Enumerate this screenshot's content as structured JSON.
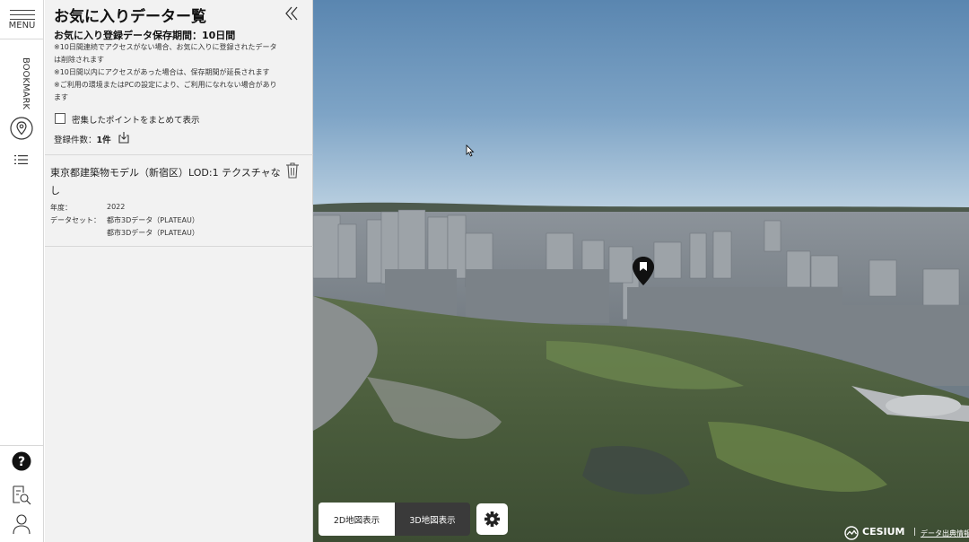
{
  "rail": {
    "menu_label": "MENU",
    "bookmark_label": "BOOKMARK",
    "icons": [
      "hamburger-icon",
      "location-pin-icon",
      "list-icon",
      "help-icon",
      "search-document-icon",
      "user-icon"
    ]
  },
  "panel": {
    "title": "お気に入りデーター覧",
    "notice_heading": "お気に入り登録データ保存期間：10日間",
    "notices": [
      "※10日間連続でアクセスがない場合、お気に入りに登録されたデータ",
      "は削除されます",
      "※10日間以内にアクセスがあった場合は、保存期間が延長されます",
      "※ご利用の環境またはPCの設定により、ご利用になれない場合があり",
      "ます"
    ],
    "cluster_checkbox_label": "密集したポイントをまとめて表示",
    "cluster_checked": false,
    "count_label": "登録件数：",
    "count_value": "1件",
    "item": {
      "title": "東京都建築物モデル（新宿区）LOD:1 テクスチャなし",
      "year_label": "年度：",
      "year_value": "2022",
      "dataset_label": "データセット：",
      "dataset_values": [
        "都市3Dデータ（PLATEAU）",
        "都市3Dデータ（PLATEAU）"
      ]
    }
  },
  "map": {
    "btn_2d": "2D地図表示",
    "btn_3d": "3D地図表示",
    "active_mode": "3D地図表示",
    "cesium_logo": "CESIUM",
    "credit_sep": "|",
    "credit_link": "データ出典情報"
  },
  "colors": {
    "panel_bg": "#f2f2f2",
    "active_toggle": "#3a3a3a",
    "pin": "#111111"
  }
}
